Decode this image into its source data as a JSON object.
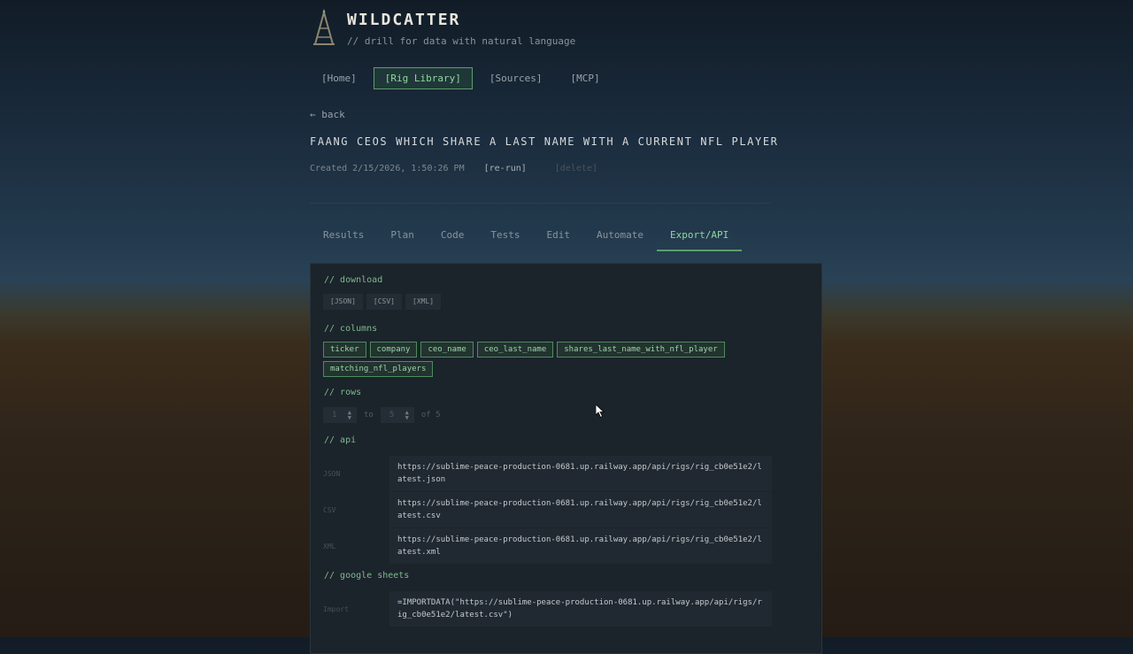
{
  "header": {
    "brand": "WILDCATTER",
    "tagline": "// drill for data with natural language"
  },
  "nav": [
    {
      "label": "[Home]",
      "active": false
    },
    {
      "label": "[Rig Library]",
      "active": true
    },
    {
      "label": "[Sources]",
      "active": false
    },
    {
      "label": "[MCP]",
      "active": false
    }
  ],
  "back_label": "← back",
  "rig": {
    "title": "FAANG CEOs which share a last name with a current NFL player",
    "created": "Created 2/15/2026, 1:50:26 PM",
    "rerun_label": "[re-run]",
    "delete_label": "[delete]"
  },
  "tabs": [
    {
      "label": "Results",
      "active": false
    },
    {
      "label": "Plan",
      "active": false
    },
    {
      "label": "Code",
      "active": false
    },
    {
      "label": "Tests",
      "active": false
    },
    {
      "label": "Edit",
      "active": false
    },
    {
      "label": "Automate",
      "active": false
    },
    {
      "label": "Export/API",
      "active": true
    }
  ],
  "export": {
    "download_heading": "// download",
    "download_buttons": [
      "[JSON]",
      "[CSV]",
      "[XML]"
    ],
    "columns_heading": "// columns",
    "columns": [
      "ticker",
      "company",
      "ceo_name",
      "ceo_last_name",
      "shares_last_name_with_nfl_player",
      "matching_nfl_players"
    ],
    "rows_heading": "// rows",
    "rows_from": "1",
    "rows_to_label": "to",
    "rows_to": "5",
    "rows_of": "of 5",
    "api_heading": "// api",
    "api": [
      {
        "label": "JSON",
        "url": "https://sublime-peace-production-0681.up.railway.app/api/rigs/rig_cb0e51e2/latest.json"
      },
      {
        "label": "CSV",
        "url": "https://sublime-peace-production-0681.up.railway.app/api/rigs/rig_cb0e51e2/latest.csv"
      },
      {
        "label": "XML",
        "url": "https://sublime-peace-production-0681.up.railway.app/api/rigs/rig_cb0e51e2/latest.xml"
      }
    ],
    "sheets_heading": "// google sheets",
    "sheets_label": "Import",
    "sheets_formula": "=IMPORTDATA(\"https://sublime-peace-production-0681.up.railway.app/api/rigs/rig_cb0e51e2/latest.csv\")"
  },
  "colors": {
    "accent": "#8fd6a0",
    "accent_border": "#5aa06a",
    "panel_bg": "#1b232b"
  }
}
